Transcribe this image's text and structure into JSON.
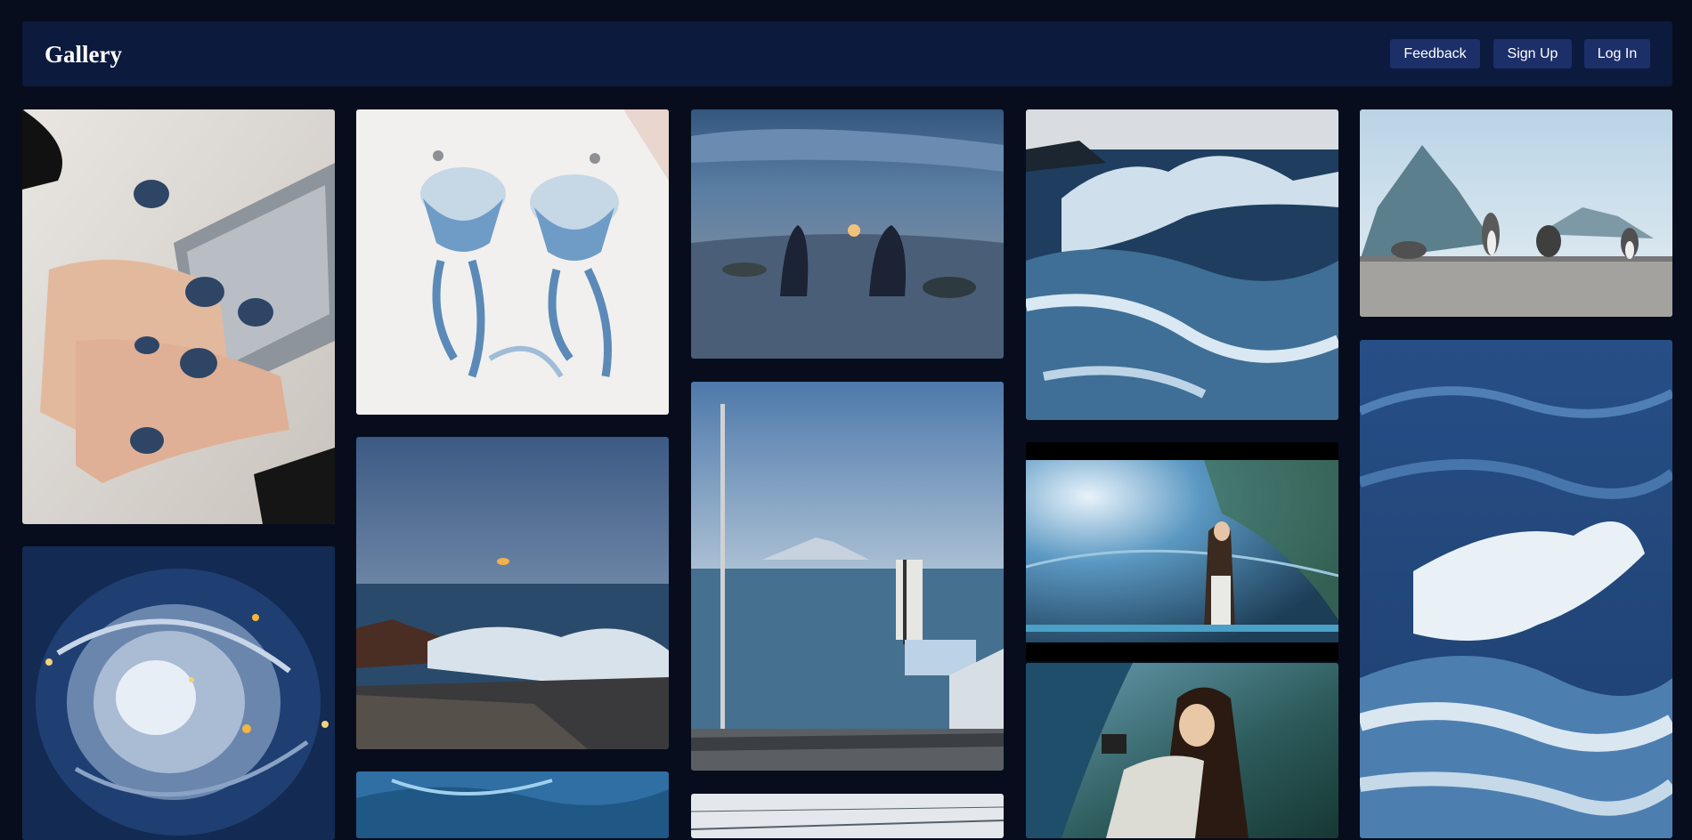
{
  "header": {
    "brand": "Gallery",
    "buttons": {
      "feedback": "Feedback",
      "signup": "Sign Up",
      "login": "Log In"
    }
  },
  "colors": {
    "page_bg": "#070d1d",
    "header_bg": "#0c1a3d",
    "button_bg": "#1c2f69"
  },
  "gallery": {
    "columns": 5,
    "items": [
      "hands-navy-nails-phone",
      "cosmic-swirl-painting",
      "jellyfish-earrings",
      "moonrise-over-sea-rocks",
      "blue-ocean-water",
      "two-people-on-dune-moon",
      "seaside-road-mount-fuji",
      "overcast-beach-sky",
      "crashing-ocean-waves",
      "woman-in-aquarium-tunnel",
      "woman-aquarium-holding-camera",
      "cats-on-seawall",
      "large-blue-wave-splash"
    ]
  }
}
